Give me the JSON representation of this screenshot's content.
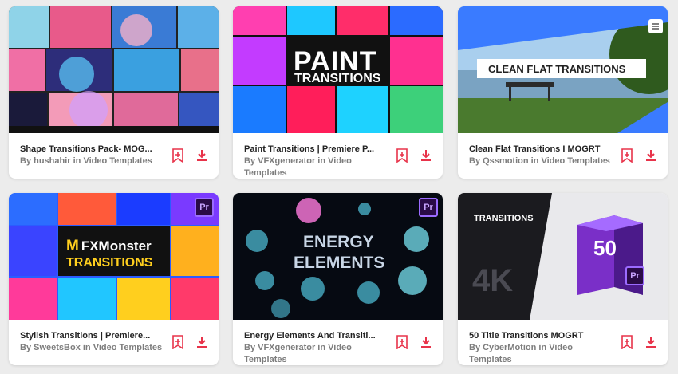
{
  "cards": [
    {
      "title": "Shape Transitions Pack- MOG...",
      "byline": "By hushahir in Video Templates"
    },
    {
      "title": "Paint Transitions | Premiere P...",
      "byline": "By VFXgenerator in Video Templates",
      "thumb_line1": "PAINT",
      "thumb_line2": "TRANSITIONS"
    },
    {
      "title": "Clean Flat Transitions I MOGRT",
      "byline": "By Qssmotion in Video Templates",
      "thumb_text": "CLEAN FLAT TRANSITIONS"
    },
    {
      "title": "Stylish Transitions | Premiere...",
      "byline": "By SweetsBox in Video Templates",
      "thumb_brand": "FXMonster",
      "thumb_brand_m": "M",
      "thumb_sub": "TRANSITIONS",
      "badge": "Pr"
    },
    {
      "title": "Energy Elements And Transiti...",
      "byline": "By VFXgenerator in Video Templates",
      "thumb_line1": "ENERGY",
      "thumb_line2": "ELEMENTS",
      "badge": "Pr"
    },
    {
      "title": "50 Title Transitions MOGRT",
      "byline": "By CyberMotion in Video Templates",
      "thumb_head": "TRANSITIONS",
      "thumb_big": "4K",
      "thumb_box_num": "50",
      "badge": "Pr"
    }
  ],
  "colors": {
    "accent": "#e8334a",
    "bg": "#ececec"
  },
  "icons": {
    "save": "bookmark-plus-icon",
    "download": "download-icon"
  }
}
